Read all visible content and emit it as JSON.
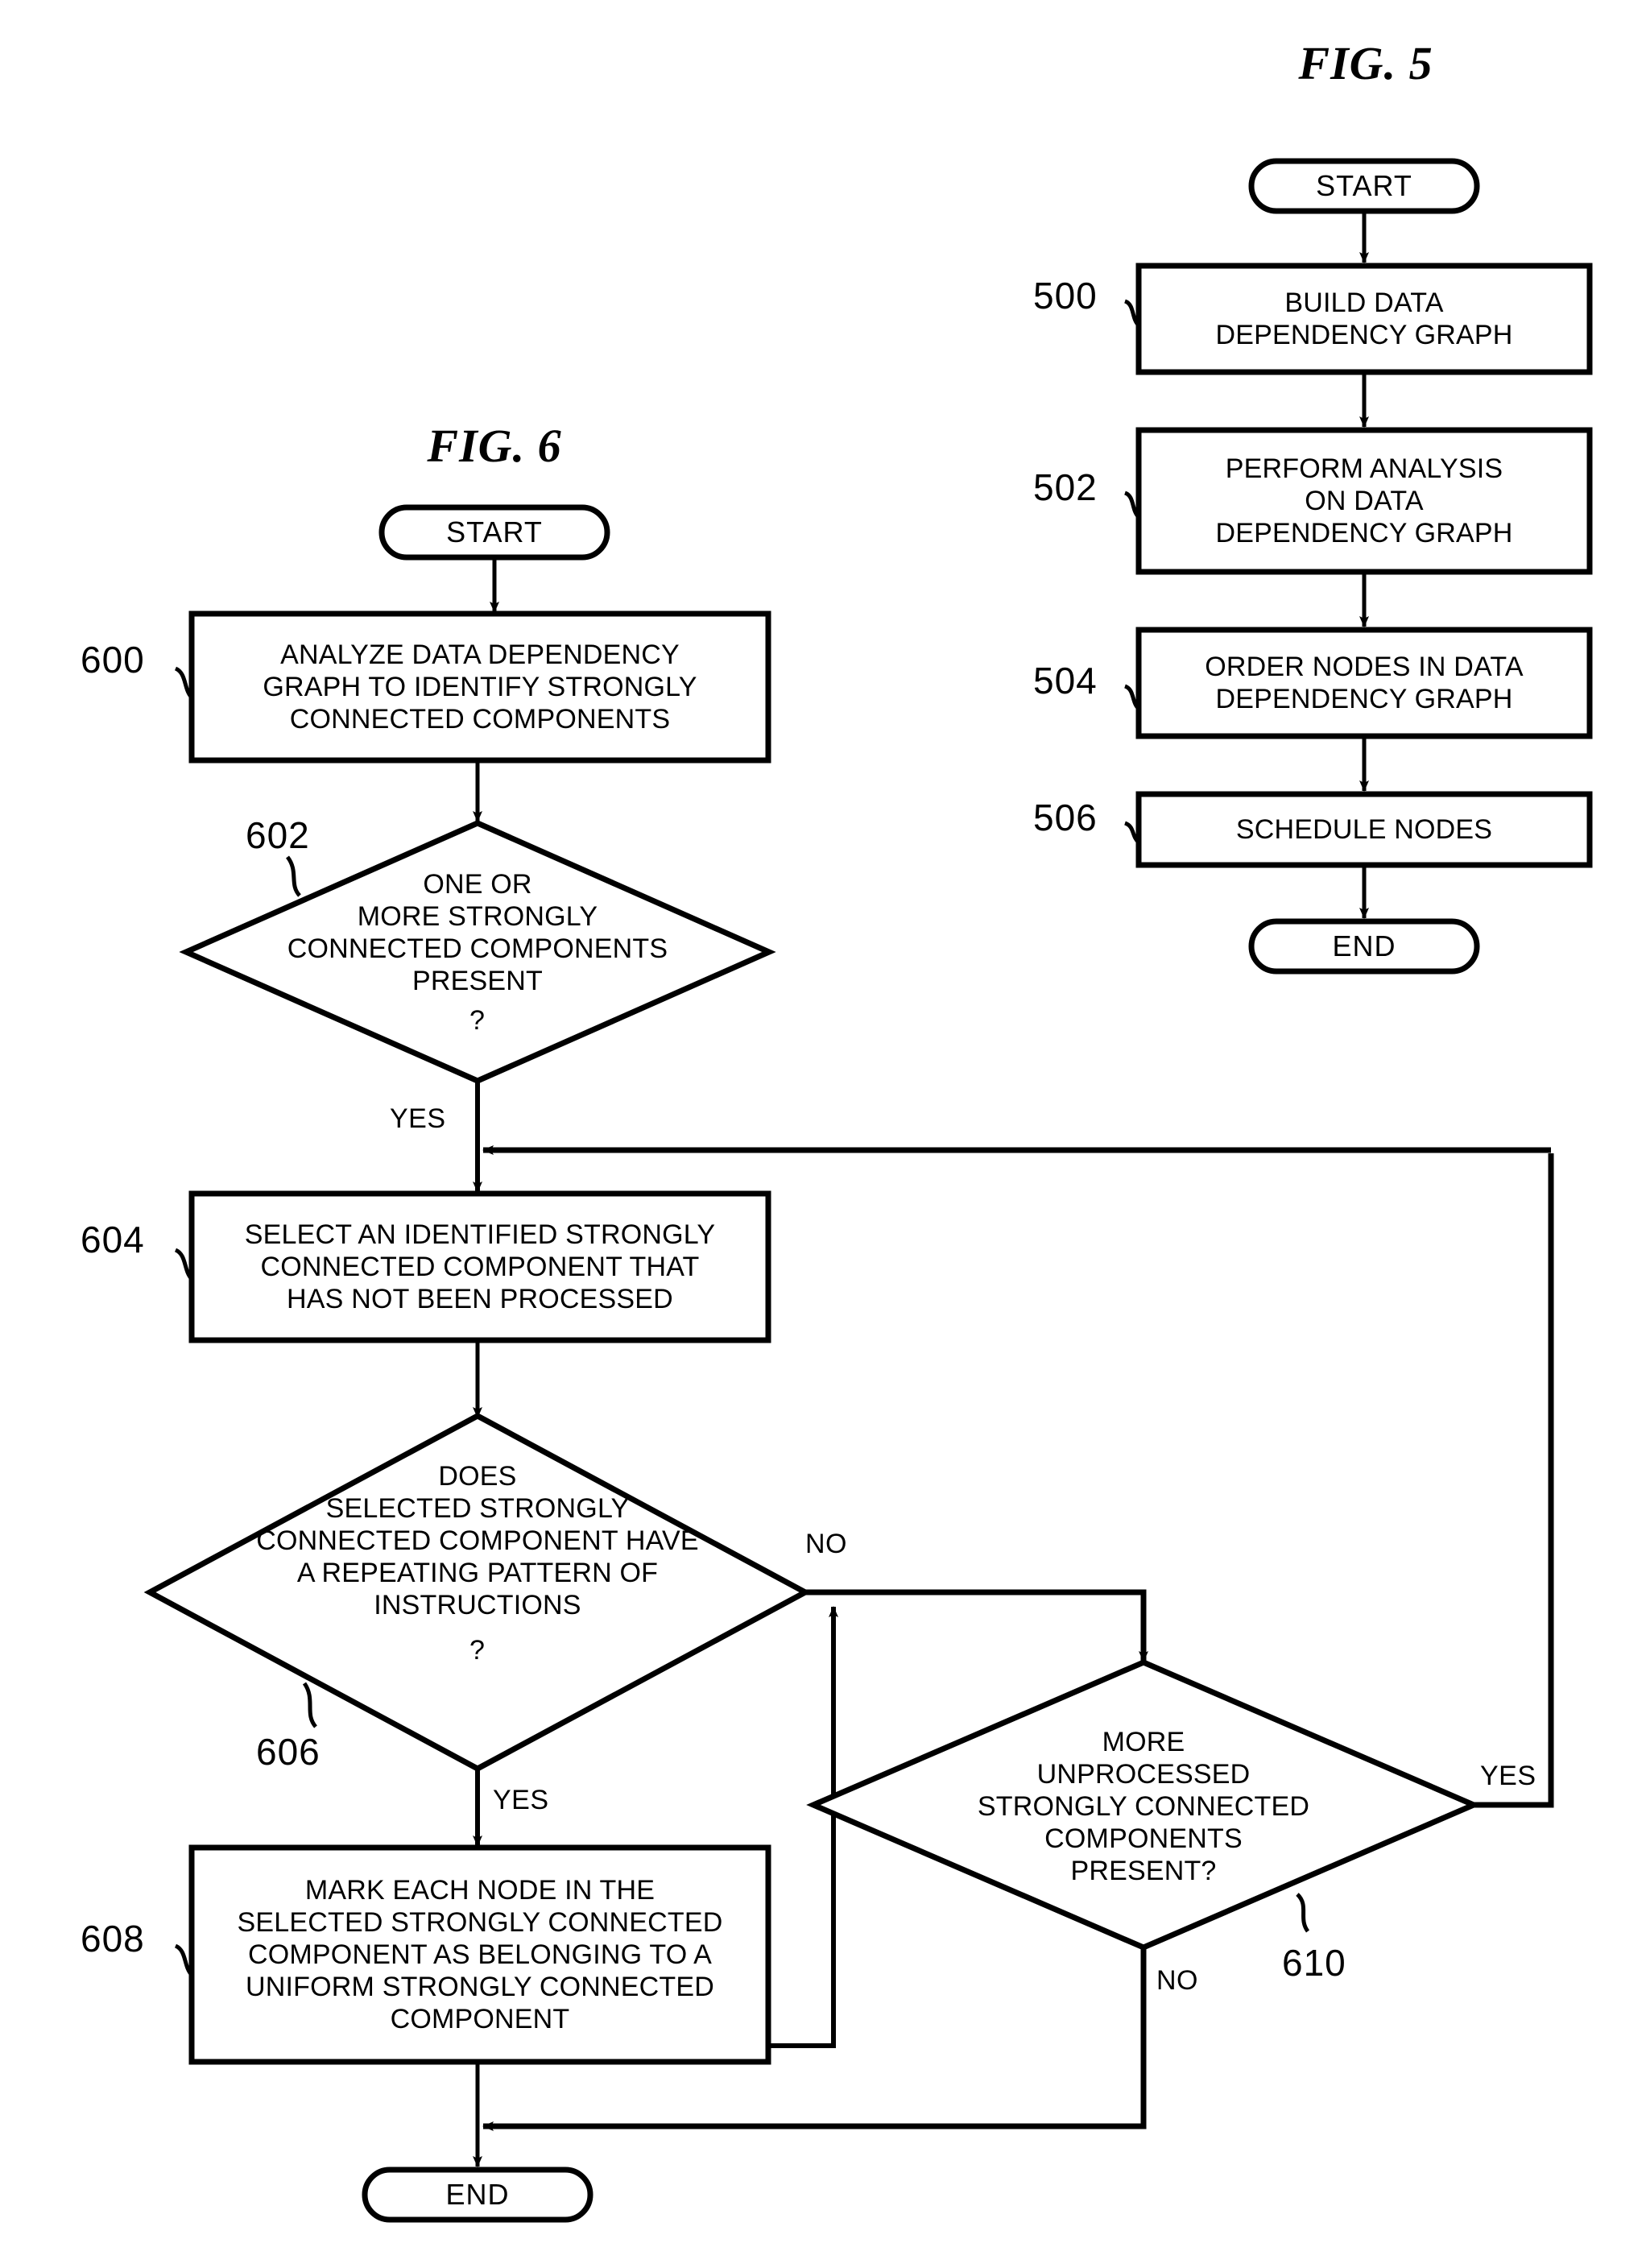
{
  "page": {
    "background": "#ffffff",
    "ink": "#000000"
  },
  "figures": [
    {
      "id": "fig5",
      "title": "FIG. 5",
      "terminals": {
        "start": "START",
        "end": "END"
      },
      "steps": [
        {
          "ref": "500",
          "label": "BUILD DATA\nDEPENDENCY GRAPH"
        },
        {
          "ref": "502",
          "label": "PERFORM ANALYSIS\nON DATA\nDEPENDENCY GRAPH"
        },
        {
          "ref": "504",
          "label": "ORDER NODES IN DATA\nDEPENDENCY GRAPH"
        },
        {
          "ref": "506",
          "label": "SCHEDULE NODES"
        }
      ]
    },
    {
      "id": "fig6",
      "title": "FIG. 6",
      "terminals": {
        "start": "START",
        "end": "END"
      },
      "steps": [
        {
          "ref": "600",
          "type": "process",
          "label": "ANALYZE DATA DEPENDENCY\nGRAPH TO IDENTIFY STRONGLY\nCONNECTED COMPONENTS"
        },
        {
          "ref": "602",
          "type": "decision",
          "label": "ONE OR\nMORE STRONGLY\nCONNECTED COMPONENTS\nPRESENT",
          "question_mark": "?"
        },
        {
          "ref": "604",
          "type": "process",
          "label": "SELECT AN IDENTIFIED STRONGLY\nCONNECTED COMPONENT THAT\nHAS NOT BEEN PROCESSED"
        },
        {
          "ref": "606",
          "type": "decision",
          "label": "DOES\nSELECTED STRONGLY\nCONNECTED COMPONENT HAVE\nA REPEATING PATTERN OF\nINSTRUCTIONS",
          "question_mark": "?"
        },
        {
          "ref": "608",
          "type": "process",
          "label": "MARK EACH NODE IN THE\nSELECTED STRONGLY CONNECTED\nCOMPONENT AS BELONGING TO A\nUNIFORM STRONGLY CONNECTED\nCOMPONENT"
        },
        {
          "ref": "610",
          "type": "decision",
          "label": "MORE\nUNPROCESSED\nSTRONGLY CONNECTED\nCOMPONENTS\nPRESENT?"
        }
      ],
      "edge_labels": {
        "from_602_yes": "YES",
        "from_606_no": "NO",
        "from_606_yes": "YES",
        "from_610_yes": "YES",
        "from_610_no": "NO"
      }
    }
  ]
}
